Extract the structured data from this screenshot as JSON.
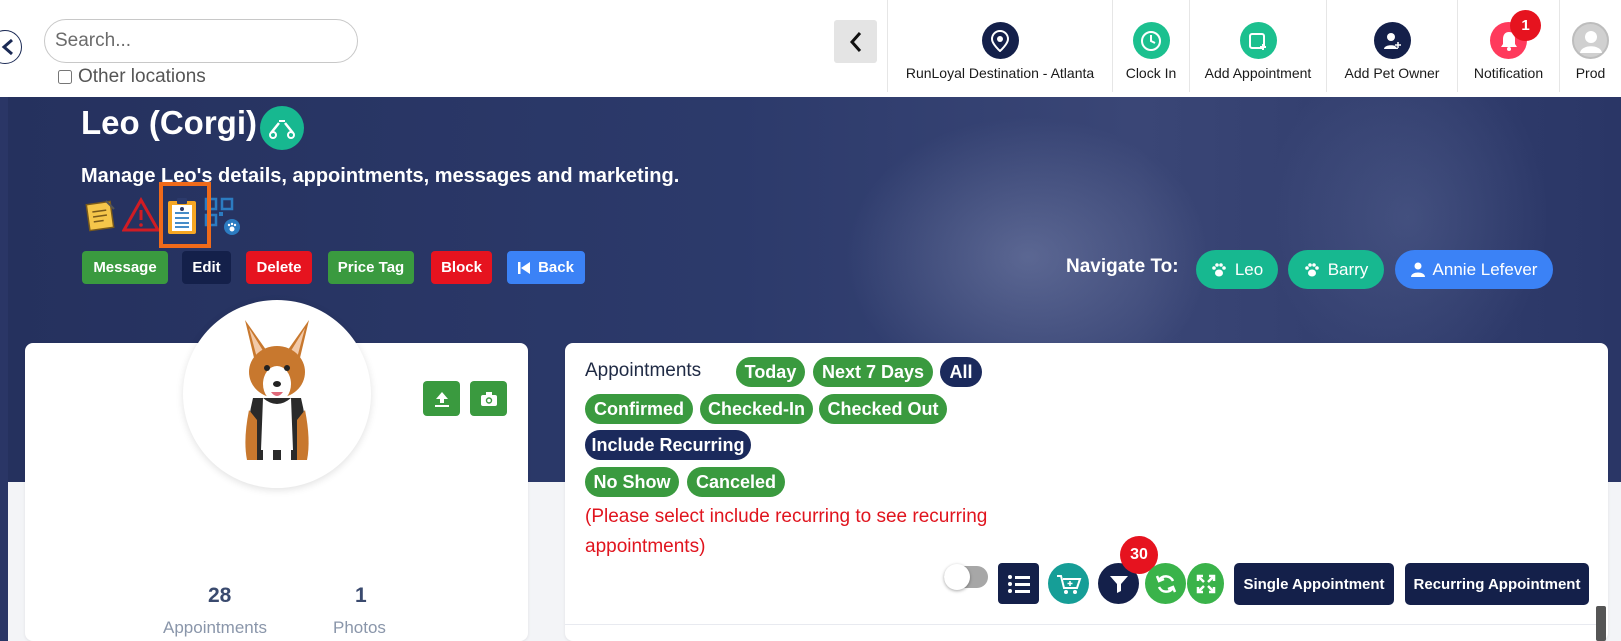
{
  "header": {
    "search": {
      "placeholder": "Search..."
    },
    "other_locations_label": "Other locations",
    "nav": [
      {
        "label": "RunLoyal Destination - Atlanta",
        "icon": "location-pin-icon",
        "color": "#14204a"
      },
      {
        "label": "Clock In",
        "icon": "clock-icon",
        "color": "#1cc08f"
      },
      {
        "label": "Add Appointment",
        "icon": "calendar-add-icon",
        "color": "#1cc08f"
      },
      {
        "label": "Add Pet Owner",
        "icon": "user-add-icon",
        "color": "#14204a"
      },
      {
        "label": "Notification",
        "icon": "bell-icon",
        "color": "#ff3a5c",
        "badge": "1"
      },
      {
        "label": "Prod",
        "icon": "avatar-icon",
        "color": "#bdbdbd"
      }
    ]
  },
  "pet": {
    "title": "Leo (Corgi)",
    "subtitle": "Manage Leo's details, appointments, messages and marketing.",
    "doc_icons": [
      "sticky-note-icon",
      "warning-triangle-icon",
      "clipboard-icon",
      "qr-code-icon"
    ]
  },
  "actions": [
    {
      "label": "Message",
      "color": "#3a9a3f"
    },
    {
      "label": "Edit",
      "color": "#14204a"
    },
    {
      "label": "Delete",
      "color": "#e6131f"
    },
    {
      "label": "Price Tag",
      "color": "#3a9a3f"
    },
    {
      "label": "Block",
      "color": "#e6131f"
    },
    {
      "label": "Back",
      "color": "#3b82f6"
    }
  ],
  "navigate": {
    "label": "Navigate To:",
    "links": [
      {
        "label": "Leo",
        "icon": "paw-icon",
        "color": "#17b890"
      },
      {
        "label": "Barry",
        "icon": "paw-icon",
        "color": "#17b890"
      },
      {
        "label": "Annie Lefever",
        "icon": "person-icon",
        "color": "#3b82f6"
      }
    ]
  },
  "profile": {
    "stats": [
      {
        "value": "28",
        "label": "Appointments"
      },
      {
        "value": "1",
        "label": "Photos"
      }
    ]
  },
  "appointments": {
    "title": "Appointments",
    "filters_row1": [
      {
        "label": "Today",
        "style": "green"
      },
      {
        "label": "Next 7 Days",
        "style": "green"
      },
      {
        "label": "All",
        "style": "navy"
      }
    ],
    "filters_row2": [
      {
        "label": "Confirmed",
        "style": "green"
      },
      {
        "label": "Checked-In",
        "style": "green"
      },
      {
        "label": "Checked Out",
        "style": "green"
      }
    ],
    "filters_row3": [
      {
        "label": "Include Recurring",
        "style": "navy"
      }
    ],
    "filters_row4": [
      {
        "label": "No Show",
        "style": "green"
      },
      {
        "label": "Canceled",
        "style": "green"
      }
    ],
    "notice": "(Please select include recurring to see recurring appointments)",
    "filter_count": "30",
    "single_label": "Single Appointment",
    "recurring_label": "Recurring Appointment"
  }
}
